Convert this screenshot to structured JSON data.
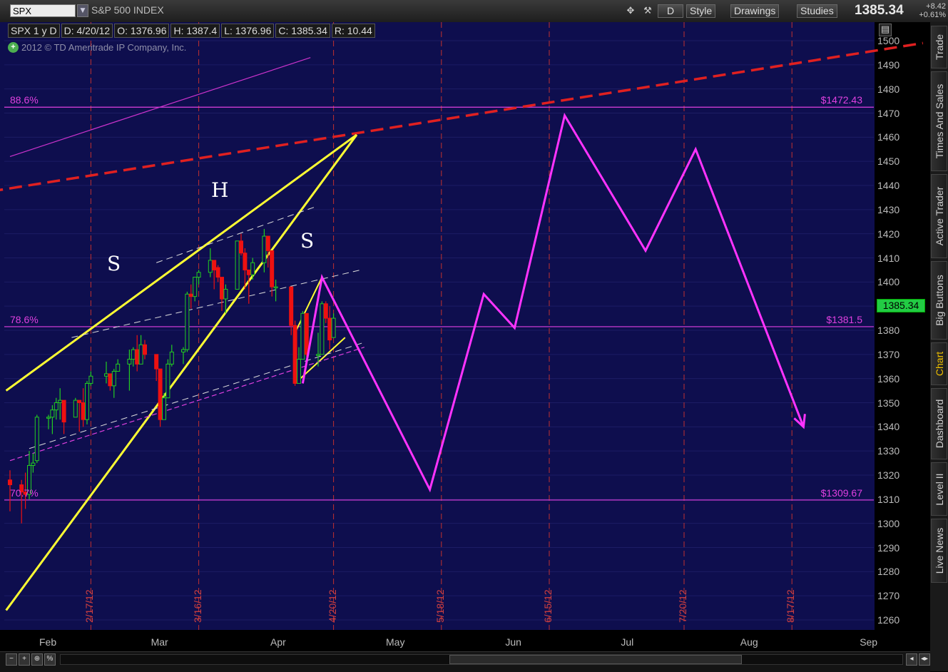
{
  "toolbar": {
    "symbol": "SPX",
    "description": "S&P 500 INDEX",
    "aggregation_button": "D",
    "style_label": "Style",
    "drawings_label": "Drawings",
    "studies_label": "Studies",
    "last_price": "1385.34",
    "change": "+8.42",
    "change_pct": "+0.61%"
  },
  "info": {
    "period": "SPX 1 y D",
    "date": "D: 4/20/12",
    "open": "O: 1376.96",
    "high": "H: 1387.4",
    "low": "L: 1376.96",
    "close": "C: 1385.34",
    "range": "R: 10.44",
    "copyright": "2012 © TD Ameritrade IP Company, Inc."
  },
  "side_tabs": [
    "Trade",
    "Times And Sales",
    "Active Trader",
    "Big Buttons",
    "Chart",
    "Dashboard",
    "Level II",
    "Live News"
  ],
  "active_tab": "Chart",
  "price_tag": "1385.34",
  "colors": {
    "background": "#0e0e4e",
    "magenta": "#ff33ff",
    "yellow": "#ffff33",
    "red_dashed": "#e02020",
    "up_candle": "#22cc22",
    "down_candle": "#ee1111"
  },
  "chart_data": {
    "type": "candlestick",
    "title": "S&P 500 INDEX",
    "ylim": [
      1255,
      1505
    ],
    "y_ticks": [
      1260,
      1270,
      1280,
      1290,
      1300,
      1310,
      1320,
      1330,
      1340,
      1350,
      1360,
      1370,
      1380,
      1390,
      1400,
      1410,
      1420,
      1430,
      1440,
      1450,
      1460,
      1470,
      1480,
      1490,
      1500
    ],
    "x_month_labels": [
      "Feb",
      "Mar",
      "Apr",
      "May",
      "Jun",
      "Jul",
      "Aug",
      "Sep"
    ],
    "vertical_date_labels": [
      "2/17/12",
      "3/16/12",
      "4/20/12",
      "5/18/12",
      "6/15/12",
      "7/20/12",
      "8/17/12"
    ],
    "fib_levels": [
      {
        "label": "88.6%",
        "price_label": "$1472.43",
        "value": 1472.43
      },
      {
        "label": "78.6%",
        "price_label": "$1381.5",
        "value": 1381.5
      },
      {
        "label": "70.7%",
        "price_label": "$1309.67",
        "value": 1309.67
      }
    ],
    "annotations": [
      "S",
      "H",
      "S"
    ],
    "projection_path": [
      {
        "date": "2012-04-12",
        "value": 1358
      },
      {
        "date": "2012-04-17",
        "value": 1402
      },
      {
        "date": "2012-05-15",
        "value": 1314
      },
      {
        "date": "2012-05-29",
        "value": 1395
      },
      {
        "date": "2012-06-06",
        "value": 1381
      },
      {
        "date": "2012-06-19",
        "value": 1469
      },
      {
        "date": "2012-07-10",
        "value": 1413
      },
      {
        "date": "2012-07-23",
        "value": 1455
      },
      {
        "date": "2012-08-20",
        "value": 1340
      }
    ],
    "candles": [
      {
        "date": "2012-01-27",
        "o": 1318,
        "h": 1322,
        "l": 1305,
        "c": 1316
      },
      {
        "date": "2012-01-30",
        "o": 1316,
        "h": 1318,
        "l": 1300,
        "c": 1313
      },
      {
        "date": "2012-01-31",
        "o": 1313,
        "h": 1321,
        "l": 1306,
        "c": 1312
      },
      {
        "date": "2012-02-01",
        "o": 1312,
        "h": 1330,
        "l": 1310,
        "c": 1324
      },
      {
        "date": "2012-02-02",
        "o": 1324,
        "h": 1329,
        "l": 1321,
        "c": 1325
      },
      {
        "date": "2012-02-03",
        "o": 1326,
        "h": 1345,
        "l": 1325,
        "c": 1344
      },
      {
        "date": "2012-02-06",
        "o": 1344,
        "h": 1345,
        "l": 1339,
        "c": 1344
      },
      {
        "date": "2012-02-07",
        "o": 1344,
        "h": 1349,
        "l": 1337,
        "c": 1347
      },
      {
        "date": "2012-02-08",
        "o": 1347,
        "h": 1352,
        "l": 1343,
        "c": 1350
      },
      {
        "date": "2012-02-09",
        "o": 1350,
        "h": 1356,
        "l": 1343,
        "c": 1351
      },
      {
        "date": "2012-02-10",
        "o": 1351,
        "h": 1351,
        "l": 1337,
        "c": 1342
      },
      {
        "date": "2012-02-13",
        "o": 1344,
        "h": 1352,
        "l": 1344,
        "c": 1351
      },
      {
        "date": "2012-02-14",
        "o": 1351,
        "h": 1351,
        "l": 1338,
        "c": 1350
      },
      {
        "date": "2012-02-15",
        "o": 1350,
        "h": 1356,
        "l": 1340,
        "c": 1343
      },
      {
        "date": "2012-02-16",
        "o": 1343,
        "h": 1359,
        "l": 1341,
        "c": 1358
      },
      {
        "date": "2012-02-17",
        "o": 1358,
        "h": 1363,
        "l": 1357,
        "c": 1361
      },
      {
        "date": "2012-02-21",
        "o": 1361,
        "h": 1367,
        "l": 1358,
        "c": 1362
      },
      {
        "date": "2012-02-22",
        "o": 1362,
        "h": 1362,
        "l": 1355,
        "c": 1357
      },
      {
        "date": "2012-02-23",
        "o": 1357,
        "h": 1364,
        "l": 1352,
        "c": 1363
      },
      {
        "date": "2012-02-24",
        "o": 1363,
        "h": 1368,
        "l": 1363,
        "c": 1366
      },
      {
        "date": "2012-02-27",
        "o": 1366,
        "h": 1372,
        "l": 1355,
        "c": 1368
      },
      {
        "date": "2012-02-28",
        "o": 1368,
        "h": 1373,
        "l": 1365,
        "c": 1372
      },
      {
        "date": "2012-02-29",
        "o": 1372,
        "h": 1378,
        "l": 1363,
        "c": 1366
      },
      {
        "date": "2012-03-01",
        "o": 1366,
        "h": 1378,
        "l": 1366,
        "c": 1374
      },
      {
        "date": "2012-03-02",
        "o": 1374,
        "h": 1376,
        "l": 1368,
        "c": 1370
      },
      {
        "date": "2012-03-05",
        "o": 1370,
        "h": 1370,
        "l": 1359,
        "c": 1364
      },
      {
        "date": "2012-03-06",
        "o": 1364,
        "h": 1364,
        "l": 1340,
        "c": 1343
      },
      {
        "date": "2012-03-07",
        "o": 1343,
        "h": 1354,
        "l": 1343,
        "c": 1352
      },
      {
        "date": "2012-03-08",
        "o": 1352,
        "h": 1368,
        "l": 1352,
        "c": 1366
      },
      {
        "date": "2012-03-09",
        "o": 1366,
        "h": 1374,
        "l": 1365,
        "c": 1371
      },
      {
        "date": "2012-03-12",
        "o": 1371,
        "h": 1373,
        "l": 1366,
        "c": 1372
      },
      {
        "date": "2012-03-13",
        "o": 1372,
        "h": 1396,
        "l": 1371,
        "c": 1395
      },
      {
        "date": "2012-03-14",
        "o": 1395,
        "h": 1399,
        "l": 1389,
        "c": 1394
      },
      {
        "date": "2012-03-15",
        "o": 1394,
        "h": 1402,
        "l": 1392,
        "c": 1402
      },
      {
        "date": "2012-03-16",
        "o": 1402,
        "h": 1405,
        "l": 1399,
        "c": 1404
      },
      {
        "date": "2012-03-19",
        "o": 1404,
        "h": 1414,
        "l": 1402,
        "c": 1409
      },
      {
        "date": "2012-03-20",
        "o": 1409,
        "h": 1409,
        "l": 1397,
        "c": 1405
      },
      {
        "date": "2012-03-21",
        "o": 1406,
        "h": 1407,
        "l": 1400,
        "c": 1402
      },
      {
        "date": "2012-03-22",
        "o": 1402,
        "h": 1402,
        "l": 1388,
        "c": 1393
      },
      {
        "date": "2012-03-23",
        "o": 1393,
        "h": 1399,
        "l": 1387,
        "c": 1397
      },
      {
        "date": "2012-03-26",
        "o": 1397,
        "h": 1417,
        "l": 1397,
        "c": 1417
      },
      {
        "date": "2012-03-27",
        "o": 1417,
        "h": 1420,
        "l": 1411,
        "c": 1412
      },
      {
        "date": "2012-03-28",
        "o": 1412,
        "h": 1414,
        "l": 1397,
        "c": 1405
      },
      {
        "date": "2012-03-29",
        "o": 1405,
        "h": 1405,
        "l": 1391,
        "c": 1403
      },
      {
        "date": "2012-03-30",
        "o": 1403,
        "h": 1410,
        "l": 1401,
        "c": 1408
      },
      {
        "date": "2012-04-02",
        "o": 1408,
        "h": 1422,
        "l": 1404,
        "c": 1419
      },
      {
        "date": "2012-04-03",
        "o": 1419,
        "h": 1419,
        "l": 1406,
        "c": 1413
      },
      {
        "date": "2012-04-04",
        "o": 1413,
        "h": 1413,
        "l": 1394,
        "c": 1398
      },
      {
        "date": "2012-04-05",
        "o": 1398,
        "h": 1401,
        "l": 1392,
        "c": 1398
      },
      {
        "date": "2012-04-09",
        "o": 1398,
        "h": 1398,
        "l": 1378,
        "c": 1382
      },
      {
        "date": "2012-04-10",
        "o": 1382,
        "h": 1384,
        "l": 1357,
        "c": 1358
      },
      {
        "date": "2012-04-11",
        "o": 1358,
        "h": 1373,
        "l": 1358,
        "c": 1368
      },
      {
        "date": "2012-04-12",
        "o": 1368,
        "h": 1388,
        "l": 1368,
        "c": 1387
      },
      {
        "date": "2012-04-13",
        "o": 1387,
        "h": 1387,
        "l": 1369,
        "c": 1370
      },
      {
        "date": "2012-04-16",
        "o": 1370,
        "h": 1379,
        "l": 1365,
        "c": 1370
      },
      {
        "date": "2012-04-17",
        "o": 1370,
        "h": 1392,
        "l": 1370,
        "c": 1391
      },
      {
        "date": "2012-04-18",
        "o": 1391,
        "h": 1392,
        "l": 1383,
        "c": 1385
      },
      {
        "date": "2012-04-19",
        "o": 1385,
        "h": 1390,
        "l": 1372,
        "c": 1376
      },
      {
        "date": "2012-04-20",
        "o": 1377,
        "h": 1387,
        "l": 1377,
        "c": 1385
      }
    ]
  }
}
